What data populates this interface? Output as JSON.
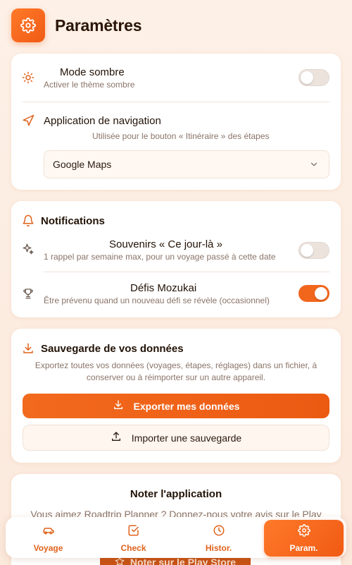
{
  "header": {
    "title": "Paramètres",
    "icon": "gear-icon"
  },
  "appearance": {
    "dark_mode": {
      "title": "Mode sombre",
      "subtitle": "Activer le thème sombre",
      "enabled": false
    },
    "navigation": {
      "title": "Application de navigation",
      "subtitle": "Utilisée pour le bouton « Itinéraire » des étapes",
      "selected": "Google Maps"
    }
  },
  "notifications": {
    "title": "Notifications",
    "memories": {
      "title": "Souvenirs « Ce jour-là »",
      "subtitle": "1 rappel par semaine max, pour un voyage passé à cette date",
      "enabled": false
    },
    "challenges": {
      "title": "Défis Mozukai",
      "subtitle": "Être prévenu quand un nouveau défi se révèle (occasionnel)",
      "enabled": true
    }
  },
  "backup": {
    "title": "Sauvegarde de vos données",
    "description": "Exportez toutes vos données (voyages, étapes, réglages) dans un fichier, à conserver ou à réimporter sur un autre appareil.",
    "export_label": "Exporter mes données",
    "import_label": "Importer une sauvegarde"
  },
  "rate": {
    "title": "Noter l'application",
    "description": "Vous aimez Roadtrip Planner ? Donnez-nous votre avis sur le Play",
    "button_label": "Noter sur le Play Store"
  },
  "nav": {
    "items": [
      {
        "label": "Voyage",
        "icon": "car-icon"
      },
      {
        "label": "Check",
        "icon": "checkbox-icon"
      },
      {
        "label": "Histor.",
        "icon": "clock-icon"
      },
      {
        "label": "Param.",
        "icon": "gear-icon"
      }
    ],
    "active_index": 3
  },
  "colors": {
    "accent": "#f05a14",
    "background": "#fdf0e6"
  }
}
